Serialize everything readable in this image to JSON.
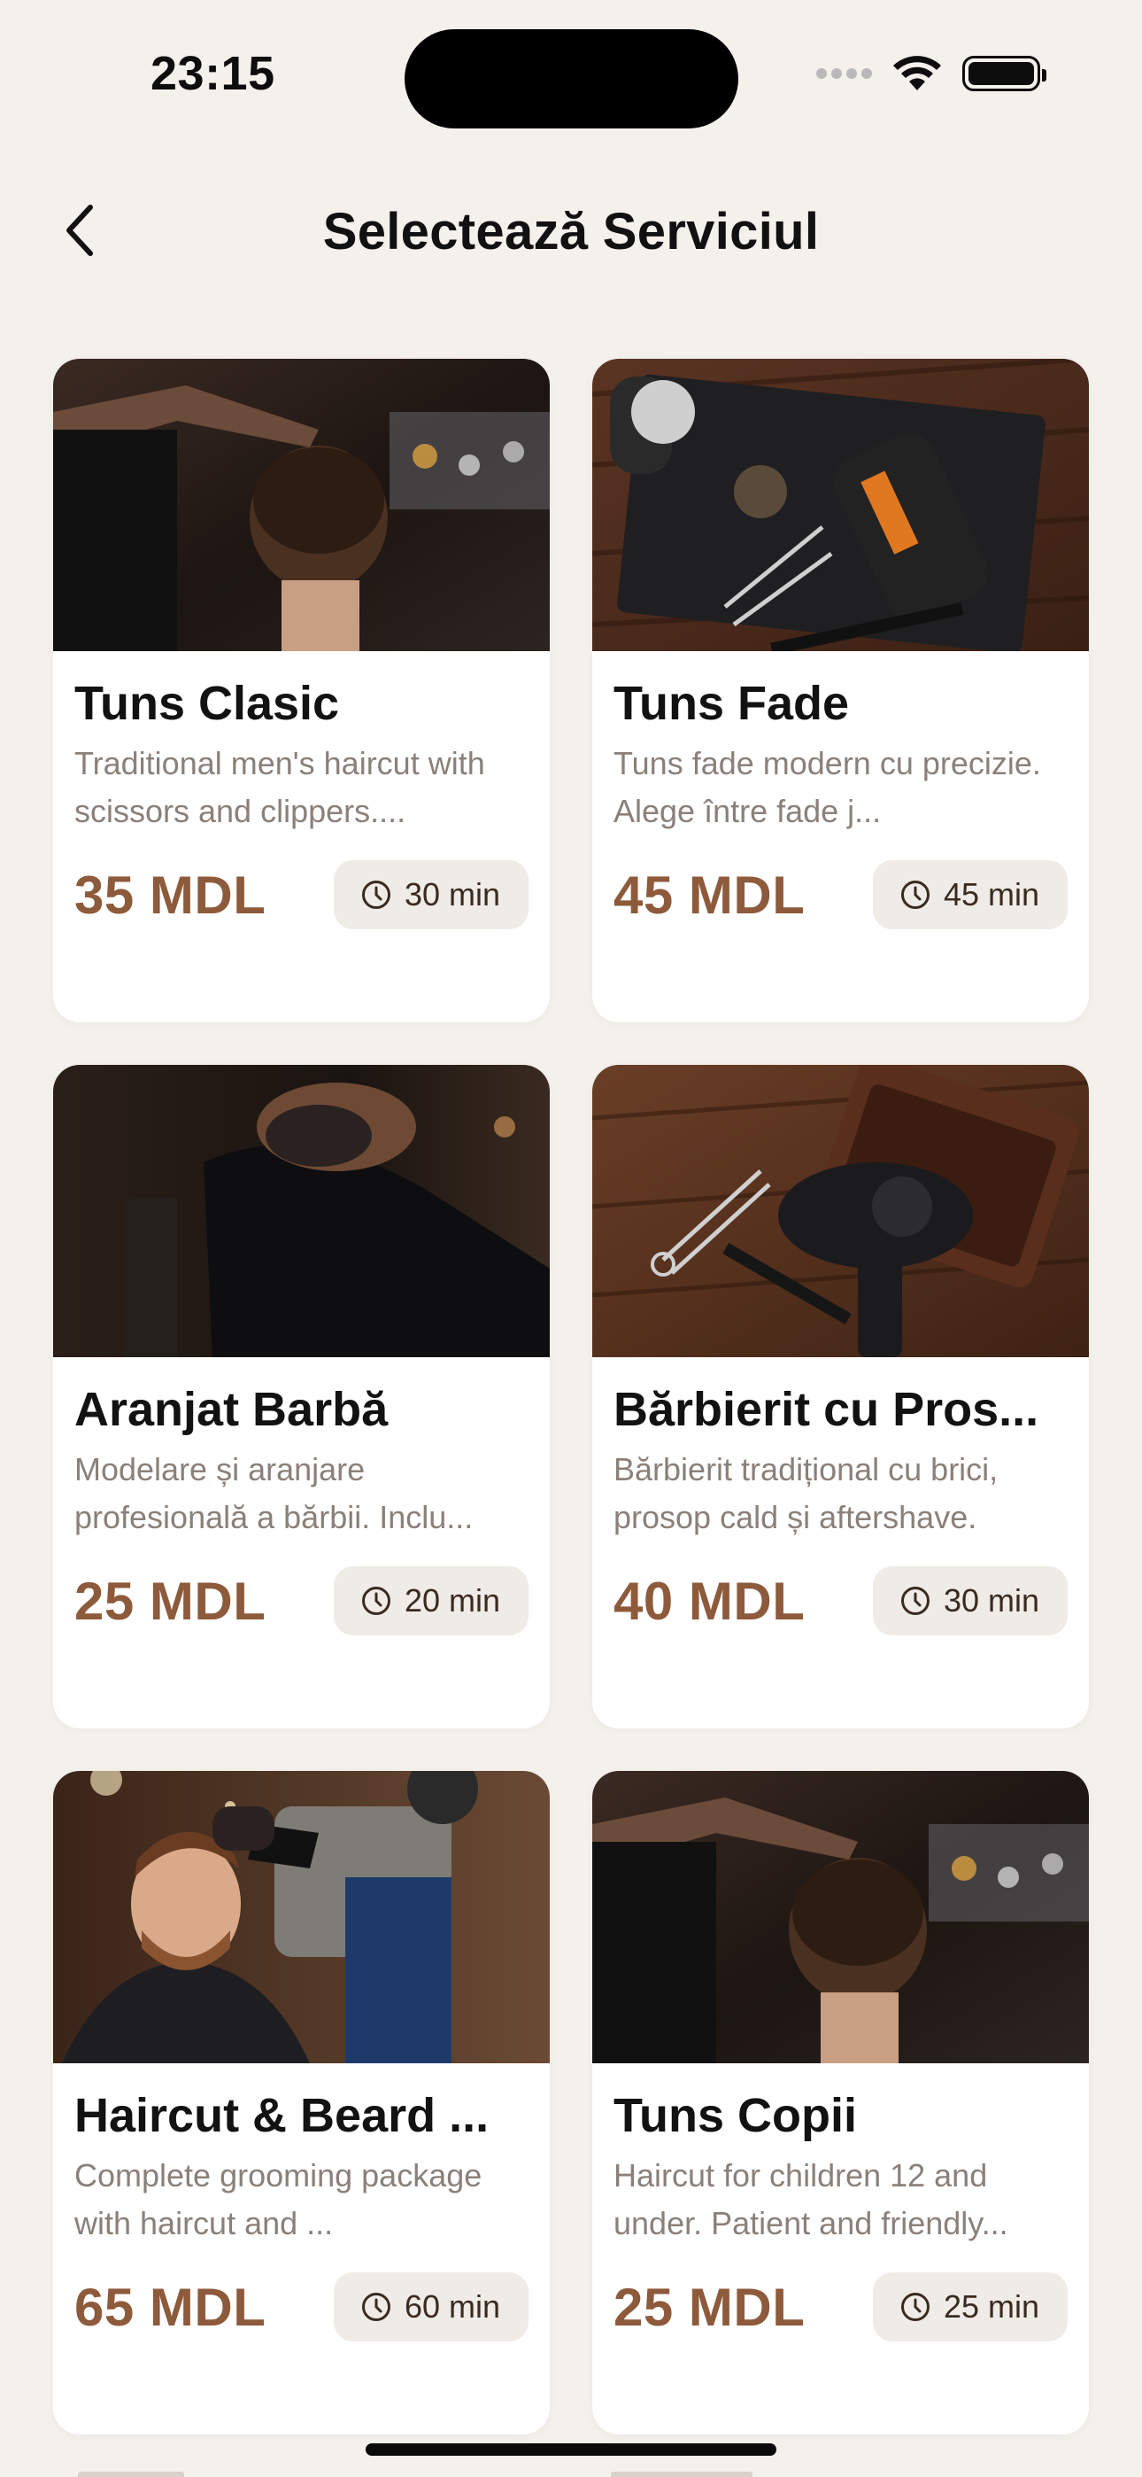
{
  "status_bar": {
    "time": "23:15"
  },
  "header": {
    "title": "Selectează Serviciul",
    "back_icon": "chevron-left-icon"
  },
  "colors": {
    "background": "#f4f1ec",
    "price": "#8d5a3b",
    "description": "#8b8079",
    "pill_background": "#efebe6"
  },
  "services": [
    {
      "title": "Tuns Clasic",
      "description": "Traditional men's haircut with scissors and clippers....",
      "price": "35 MDL",
      "duration": "30 min",
      "photo": "haircut-from-behind-photo"
    },
    {
      "title": "Tuns Fade",
      "description": "Tuns fade modern cu precizie. Alege între fade j...",
      "price": "45 MDL",
      "duration": "45 min",
      "photo": "clippers-and-tools-photo"
    },
    {
      "title": "Aranjat Barbă",
      "description": "Modelare și aranjare profesională a bărbii. Inclu...",
      "price": "25 MDL",
      "duration": "20 min",
      "photo": "beard-trim-photo"
    },
    {
      "title": "Bărbierit cu Pros...",
      "description": "Bărbierit tradițional cu brici, prosop cald și aftershave.",
      "price": "40 MDL",
      "duration": "30 min",
      "photo": "hair-dryer-and-scissors-photo"
    },
    {
      "title": "Haircut & Beard ...",
      "description": "Complete grooming package with haircut and ...",
      "price": "65 MDL",
      "duration": "60 min",
      "photo": "barber-blow-drying-photo"
    },
    {
      "title": "Tuns Copii",
      "description": "Haircut for children 12 and under. Patient and friendly...",
      "price": "25 MDL",
      "duration": "25 min",
      "photo": "haircut-from-behind-photo"
    }
  ]
}
